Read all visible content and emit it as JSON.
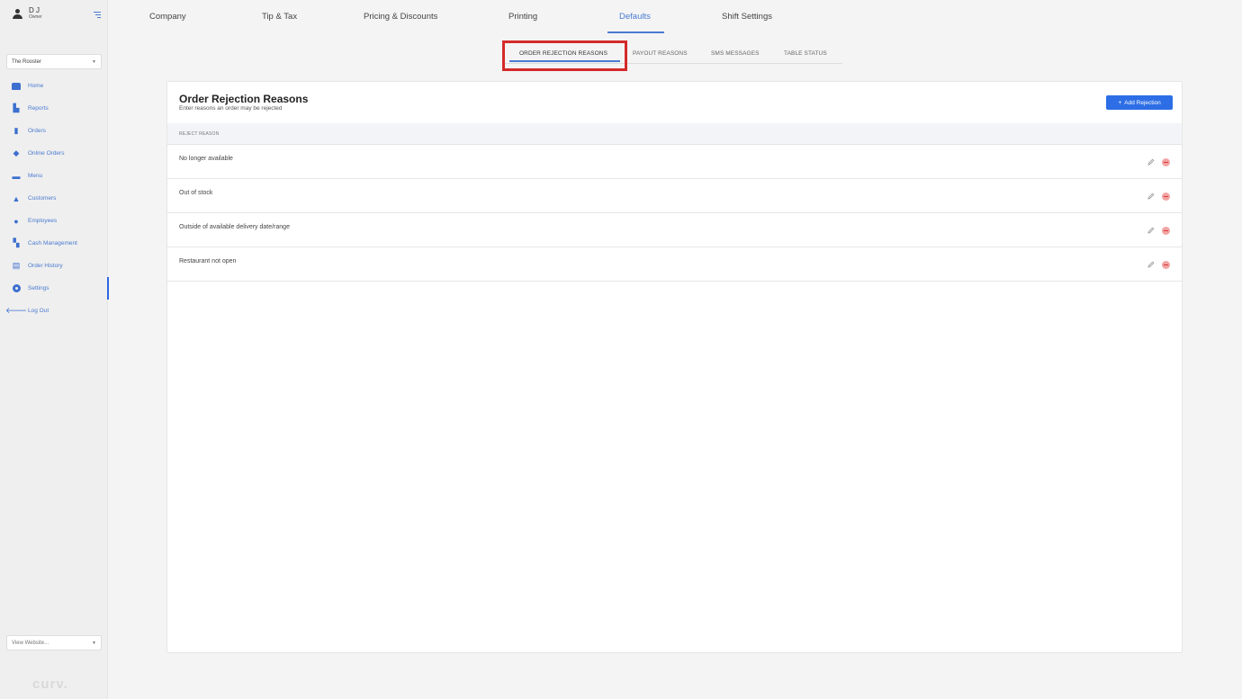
{
  "user": {
    "name": "D J",
    "role": "Owner"
  },
  "store_select": {
    "value": "The Rooster"
  },
  "website_select": {
    "value": "View Website..."
  },
  "sidebar": {
    "items": [
      {
        "label": "Home",
        "icon": "home-icon"
      },
      {
        "label": "Reports",
        "icon": "chart-icon"
      },
      {
        "label": "Orders",
        "icon": "orders-icon"
      },
      {
        "label": "Online Orders",
        "icon": "graduation-cap-icon"
      },
      {
        "label": "Menu",
        "icon": "menu-icon"
      },
      {
        "label": "Customers",
        "icon": "customers-icon"
      },
      {
        "label": "Employees",
        "icon": "employee-icon"
      },
      {
        "label": "Cash Management",
        "icon": "cash-icon"
      },
      {
        "label": "Order History",
        "icon": "history-icon"
      },
      {
        "label": "Settings",
        "icon": "gear-icon"
      },
      {
        "label": "Log Out",
        "icon": "arrow-left-icon"
      }
    ],
    "active": "Settings"
  },
  "logo": {
    "text": "curv."
  },
  "top_tabs": [
    "Company",
    "Tip & Tax",
    "Pricing & Discounts",
    "Printing",
    "Defaults",
    "Shift Settings"
  ],
  "active_top_tab": "Defaults",
  "sub_tabs": [
    "ORDER REJECTION REASONS",
    "PAYOUT REASONS",
    "SMS MESSAGES",
    "TABLE STATUS"
  ],
  "active_sub_tab": "ORDER REJECTION REASONS",
  "card": {
    "title": "Order Rejection Reasons",
    "subtitle": "Enter reasons an order may be rejected",
    "add_button": "Add Rejection",
    "column_header": "REJECT REASON",
    "rows": [
      "No longer available",
      "Out of stock",
      "Outside of available delivery date/range",
      "Restaurant not open"
    ]
  },
  "colors": {
    "accent": "#2d6ee6",
    "link": "#4a7bd0",
    "highlight": "#d42a2a",
    "delete": "#d43c3c"
  }
}
